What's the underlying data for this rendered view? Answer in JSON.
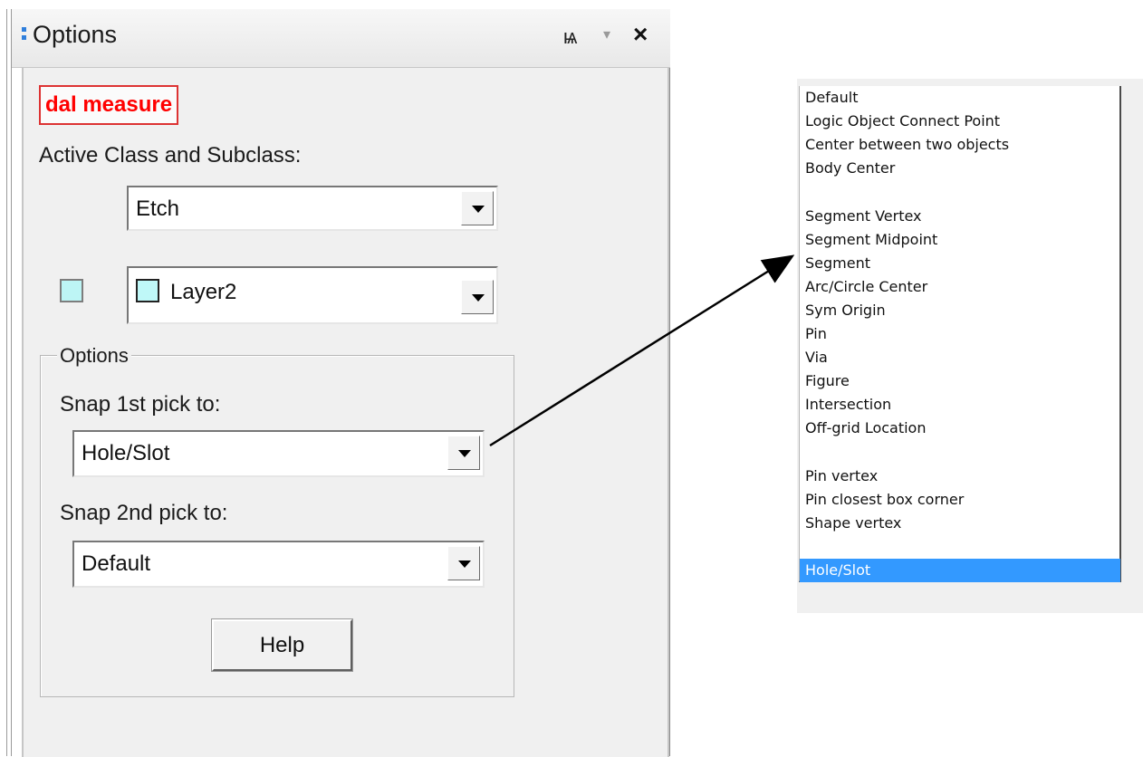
{
  "panel": {
    "title": "Options",
    "pin_glyph": "ѩ",
    "menu_glyph": "▾",
    "close_glyph": "×",
    "command_name": "dal measure",
    "active_class_label": "Active Class and Subclass:",
    "class_value": "Etch",
    "subclass_value": "Layer2",
    "group_label": "Options",
    "snap1_label": "Snap 1st pick to:",
    "snap1_value": "Hole/Slot",
    "snap2_label": "Snap 2nd pick to:",
    "snap2_value": "Default",
    "help_label": "Help"
  },
  "colors": {
    "accent": "#3399ff",
    "command_text": "#ff0000",
    "layer_color": "#bff8f8"
  },
  "dropdown_list": {
    "items": [
      "Default",
      "Logic Object Connect Point",
      "Center between two objects",
      "Body Center",
      "",
      "Segment Vertex",
      "Segment Midpoint",
      "Segment",
      "Arc/Circle Center",
      "Sym Origin",
      "Pin",
      "Via",
      "Figure",
      "Intersection",
      "Off-grid Location",
      "",
      "Pin vertex",
      "Pin closest box corner",
      "Shape vertex",
      "",
      "Hole/Slot"
    ],
    "selected": "Hole/Slot"
  }
}
